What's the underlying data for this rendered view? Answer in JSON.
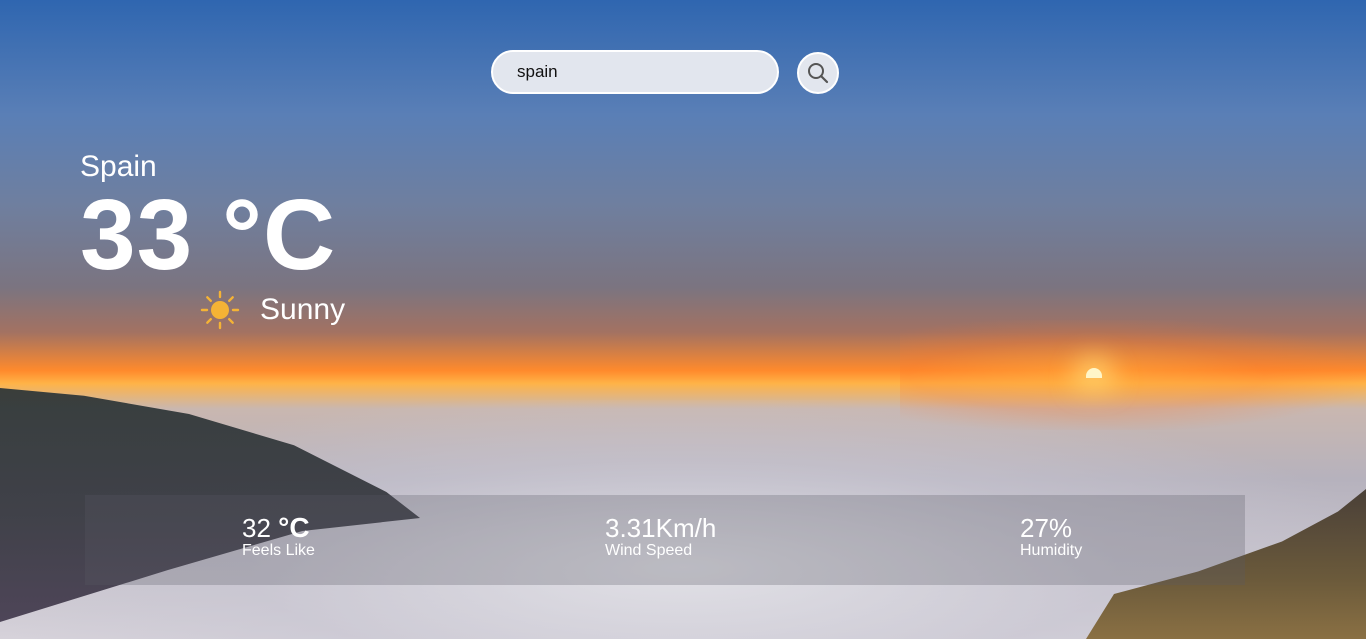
{
  "search": {
    "value": "spain",
    "placeholder": ""
  },
  "current": {
    "city": "Spain",
    "temperature": "33 °C",
    "condition": "Sunny",
    "condition_icon": "sun-icon"
  },
  "details": {
    "feels_like": {
      "value": "32",
      "unit": "°C",
      "label": "Feels Like"
    },
    "wind_speed": {
      "value": "3.31Km/h",
      "label": "Wind Speed"
    },
    "humidity": {
      "value": "27%",
      "label": "Humidity"
    }
  },
  "colors": {
    "sun_icon": "#f5b335",
    "text": "#ffffff",
    "input_bg": "#e2e6ee"
  }
}
